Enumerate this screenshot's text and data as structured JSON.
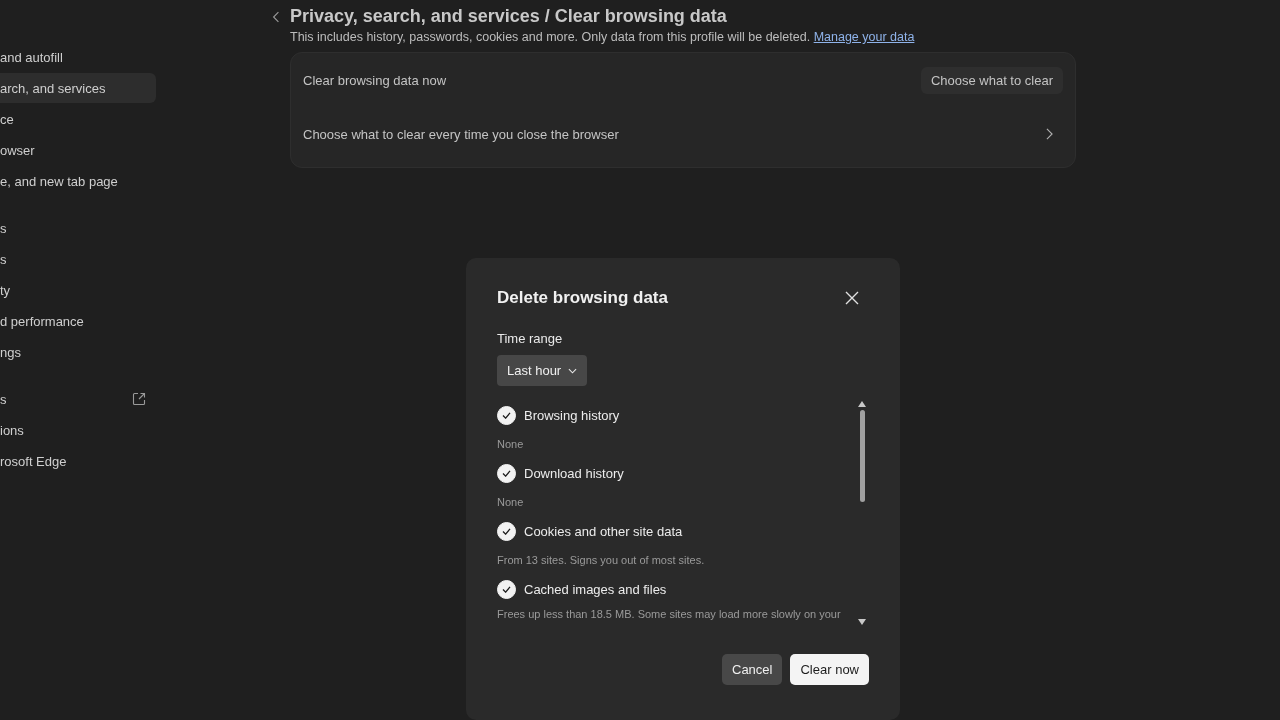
{
  "sidebar": {
    "groups": [
      {
        "items": [
          {
            "label": "and autofill",
            "selected": false,
            "external": false
          },
          {
            "label": "arch, and services",
            "selected": true,
            "external": false
          },
          {
            "label": "ce",
            "selected": false,
            "external": false
          },
          {
            "label": "owser",
            "selected": false,
            "external": false
          },
          {
            "label": "e, and new tab page",
            "selected": false,
            "external": false
          }
        ]
      },
      {
        "items": [
          {
            "label": "s",
            "selected": false,
            "external": false
          },
          {
            "label": "s",
            "selected": false,
            "external": false
          },
          {
            "label": "ty",
            "selected": false,
            "external": false
          },
          {
            "label": "d performance",
            "selected": false,
            "external": false
          },
          {
            "label": "ngs",
            "selected": false,
            "external": false
          }
        ]
      },
      {
        "items": [
          {
            "label": "s",
            "selected": false,
            "external": true
          },
          {
            "label": "ions",
            "selected": false,
            "external": false
          },
          {
            "label": "rosoft Edge",
            "selected": false,
            "external": false
          }
        ]
      }
    ]
  },
  "header": {
    "parent": "Privacy, search, and services",
    "separator": "/",
    "title": "Clear browsing data",
    "description": "This includes history, passwords, cookies and more. Only data from this profile will be deleted.",
    "link": "Manage your data"
  },
  "settings_card": {
    "rows": [
      {
        "kind": "button",
        "label": "Clear browsing data now",
        "button": "Choose what to clear"
      },
      {
        "kind": "chevron",
        "label": "Choose what to clear every time you close the browser"
      }
    ]
  },
  "dialog": {
    "title": "Delete browsing data",
    "time_range_label": "Time range",
    "time_range_value": "Last hour",
    "options": [
      {
        "label": "Browsing history",
        "checked": true,
        "detail": "None"
      },
      {
        "label": "Download history",
        "checked": true,
        "detail": "None"
      },
      {
        "label": "Cookies and other site data",
        "checked": true,
        "detail": "From 13 sites. Signs you out of most sites."
      },
      {
        "label": "Cached images and files",
        "checked": true,
        "detail": "Frees up less than 18.5 MB. Some sites may load more slowly on your"
      }
    ],
    "buttons": [
      {
        "label": "Cancel",
        "primary": false
      },
      {
        "label": "Clear now",
        "primary": true
      }
    ]
  }
}
